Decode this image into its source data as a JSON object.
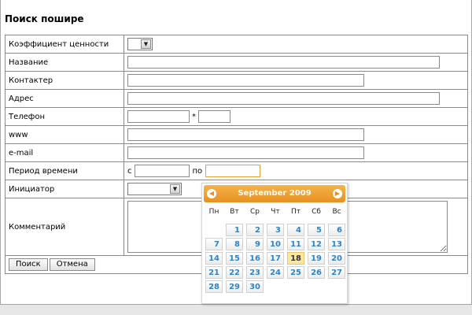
{
  "title": "Поиск пошире",
  "fields": {
    "value_coef": "Коэффициент ценности",
    "name": "Название",
    "contact": "Контактер",
    "address": "Адрес",
    "phone": "Телефон",
    "phone_sep": "*",
    "www": "www",
    "email": "e-mail",
    "period": "Период времени",
    "period_from": "с",
    "period_to": "по",
    "initiator": "Инициатор",
    "comment": "Комментарий"
  },
  "buttons": {
    "search": "Поиск",
    "cancel": "Отмена"
  },
  "calendar": {
    "month_label": "September 2009",
    "weekdays": [
      "Пн",
      "Вт",
      "Ср",
      "Чт",
      "Пт",
      "Сб",
      "Вс"
    ],
    "first_weekday_index": 1,
    "days_in_month": 30,
    "selected_day": 18,
    "prev_icon": "chevron-left-icon",
    "next_icon": "chevron-right-icon",
    "accent_color": "#e69124",
    "day_text_color": "#2f84c6"
  },
  "colors": {
    "page_bg": "#e6e6e6",
    "panel_bg": "#ffffff",
    "border": "#8a8a8a"
  }
}
